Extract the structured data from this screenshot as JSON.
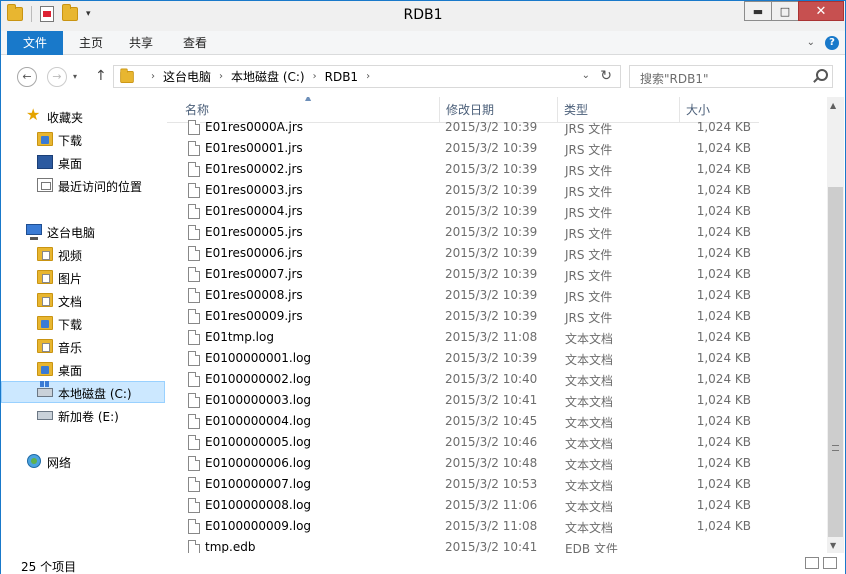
{
  "window": {
    "title": "RDB1"
  },
  "window_buttons": {
    "minimize": "▬",
    "maximize": "□",
    "close": "✕"
  },
  "ribbon": {
    "file": "文件",
    "tabs": [
      "主页",
      "共享",
      "查看"
    ],
    "help": "?"
  },
  "address": {
    "crumbs": [
      "这台电脑",
      "本地磁盘 (C:)",
      "RDB1"
    ],
    "separator": "›"
  },
  "search": {
    "placeholder": "搜索\"RDB1\""
  },
  "sidebar": {
    "favorites": {
      "label": "收藏夹",
      "items": [
        "下载",
        "桌面",
        "最近访问的位置"
      ]
    },
    "thispc": {
      "label": "这台电脑",
      "items": [
        "视频",
        "图片",
        "文档",
        "下载",
        "音乐",
        "桌面",
        "本地磁盘 (C:)",
        "新加卷 (E:)"
      ]
    },
    "network": {
      "label": "网络"
    },
    "selected": "本地磁盘 (C:)"
  },
  "columns": {
    "name": "名称",
    "date": "修改日期",
    "type": "类型",
    "size": "大小"
  },
  "files": [
    {
      "name": "E01res0000A.jrs",
      "date": "2015/3/2 10:39",
      "type": "JRS 文件",
      "size": "1,024 KB"
    },
    {
      "name": "E01res00001.jrs",
      "date": "2015/3/2 10:39",
      "type": "JRS 文件",
      "size": "1,024 KB"
    },
    {
      "name": "E01res00002.jrs",
      "date": "2015/3/2 10:39",
      "type": "JRS 文件",
      "size": "1,024 KB"
    },
    {
      "name": "E01res00003.jrs",
      "date": "2015/3/2 10:39",
      "type": "JRS 文件",
      "size": "1,024 KB"
    },
    {
      "name": "E01res00004.jrs",
      "date": "2015/3/2 10:39",
      "type": "JRS 文件",
      "size": "1,024 KB"
    },
    {
      "name": "E01res00005.jrs",
      "date": "2015/3/2 10:39",
      "type": "JRS 文件",
      "size": "1,024 KB"
    },
    {
      "name": "E01res00006.jrs",
      "date": "2015/3/2 10:39",
      "type": "JRS 文件",
      "size": "1,024 KB"
    },
    {
      "name": "E01res00007.jrs",
      "date": "2015/3/2 10:39",
      "type": "JRS 文件",
      "size": "1,024 KB"
    },
    {
      "name": "E01res00008.jrs",
      "date": "2015/3/2 10:39",
      "type": "JRS 文件",
      "size": "1,024 KB"
    },
    {
      "name": "E01res00009.jrs",
      "date": "2015/3/2 10:39",
      "type": "JRS 文件",
      "size": "1,024 KB"
    },
    {
      "name": "E01tmp.log",
      "date": "2015/3/2 11:08",
      "type": "文本文档",
      "size": "1,024 KB"
    },
    {
      "name": "E0100000001.log",
      "date": "2015/3/2 10:39",
      "type": "文本文档",
      "size": "1,024 KB"
    },
    {
      "name": "E0100000002.log",
      "date": "2015/3/2 10:40",
      "type": "文本文档",
      "size": "1,024 KB"
    },
    {
      "name": "E0100000003.log",
      "date": "2015/3/2 10:41",
      "type": "文本文档",
      "size": "1,024 KB"
    },
    {
      "name": "E0100000004.log",
      "date": "2015/3/2 10:45",
      "type": "文本文档",
      "size": "1,024 KB"
    },
    {
      "name": "E0100000005.log",
      "date": "2015/3/2 10:46",
      "type": "文本文档",
      "size": "1,024 KB"
    },
    {
      "name": "E0100000006.log",
      "date": "2015/3/2 10:48",
      "type": "文本文档",
      "size": "1,024 KB"
    },
    {
      "name": "E0100000007.log",
      "date": "2015/3/2 10:53",
      "type": "文本文档",
      "size": "1,024 KB"
    },
    {
      "name": "E0100000008.log",
      "date": "2015/3/2 11:06",
      "type": "文本文档",
      "size": "1,024 KB"
    },
    {
      "name": "E0100000009.log",
      "date": "2015/3/2 11:08",
      "type": "文本文档",
      "size": "1,024 KB"
    },
    {
      "name": "tmp.edb",
      "date": "2015/3/2 10:41",
      "type": "EDB 文件",
      "size": ""
    }
  ],
  "status": {
    "count": "25 个项目"
  },
  "colors": {
    "accent": "#1979ca",
    "selection": "#cce8ff",
    "header_text": "#4c607a",
    "meta_text": "#6d6d6d"
  },
  "icons": {
    "quick_access": [
      "folder-icon",
      "properties-icon",
      "new-folder-icon"
    ],
    "nav": [
      "back-arrow-icon",
      "forward-arrow-icon",
      "up-arrow-icon",
      "refresh-icon"
    ],
    "file": "document-icon"
  }
}
